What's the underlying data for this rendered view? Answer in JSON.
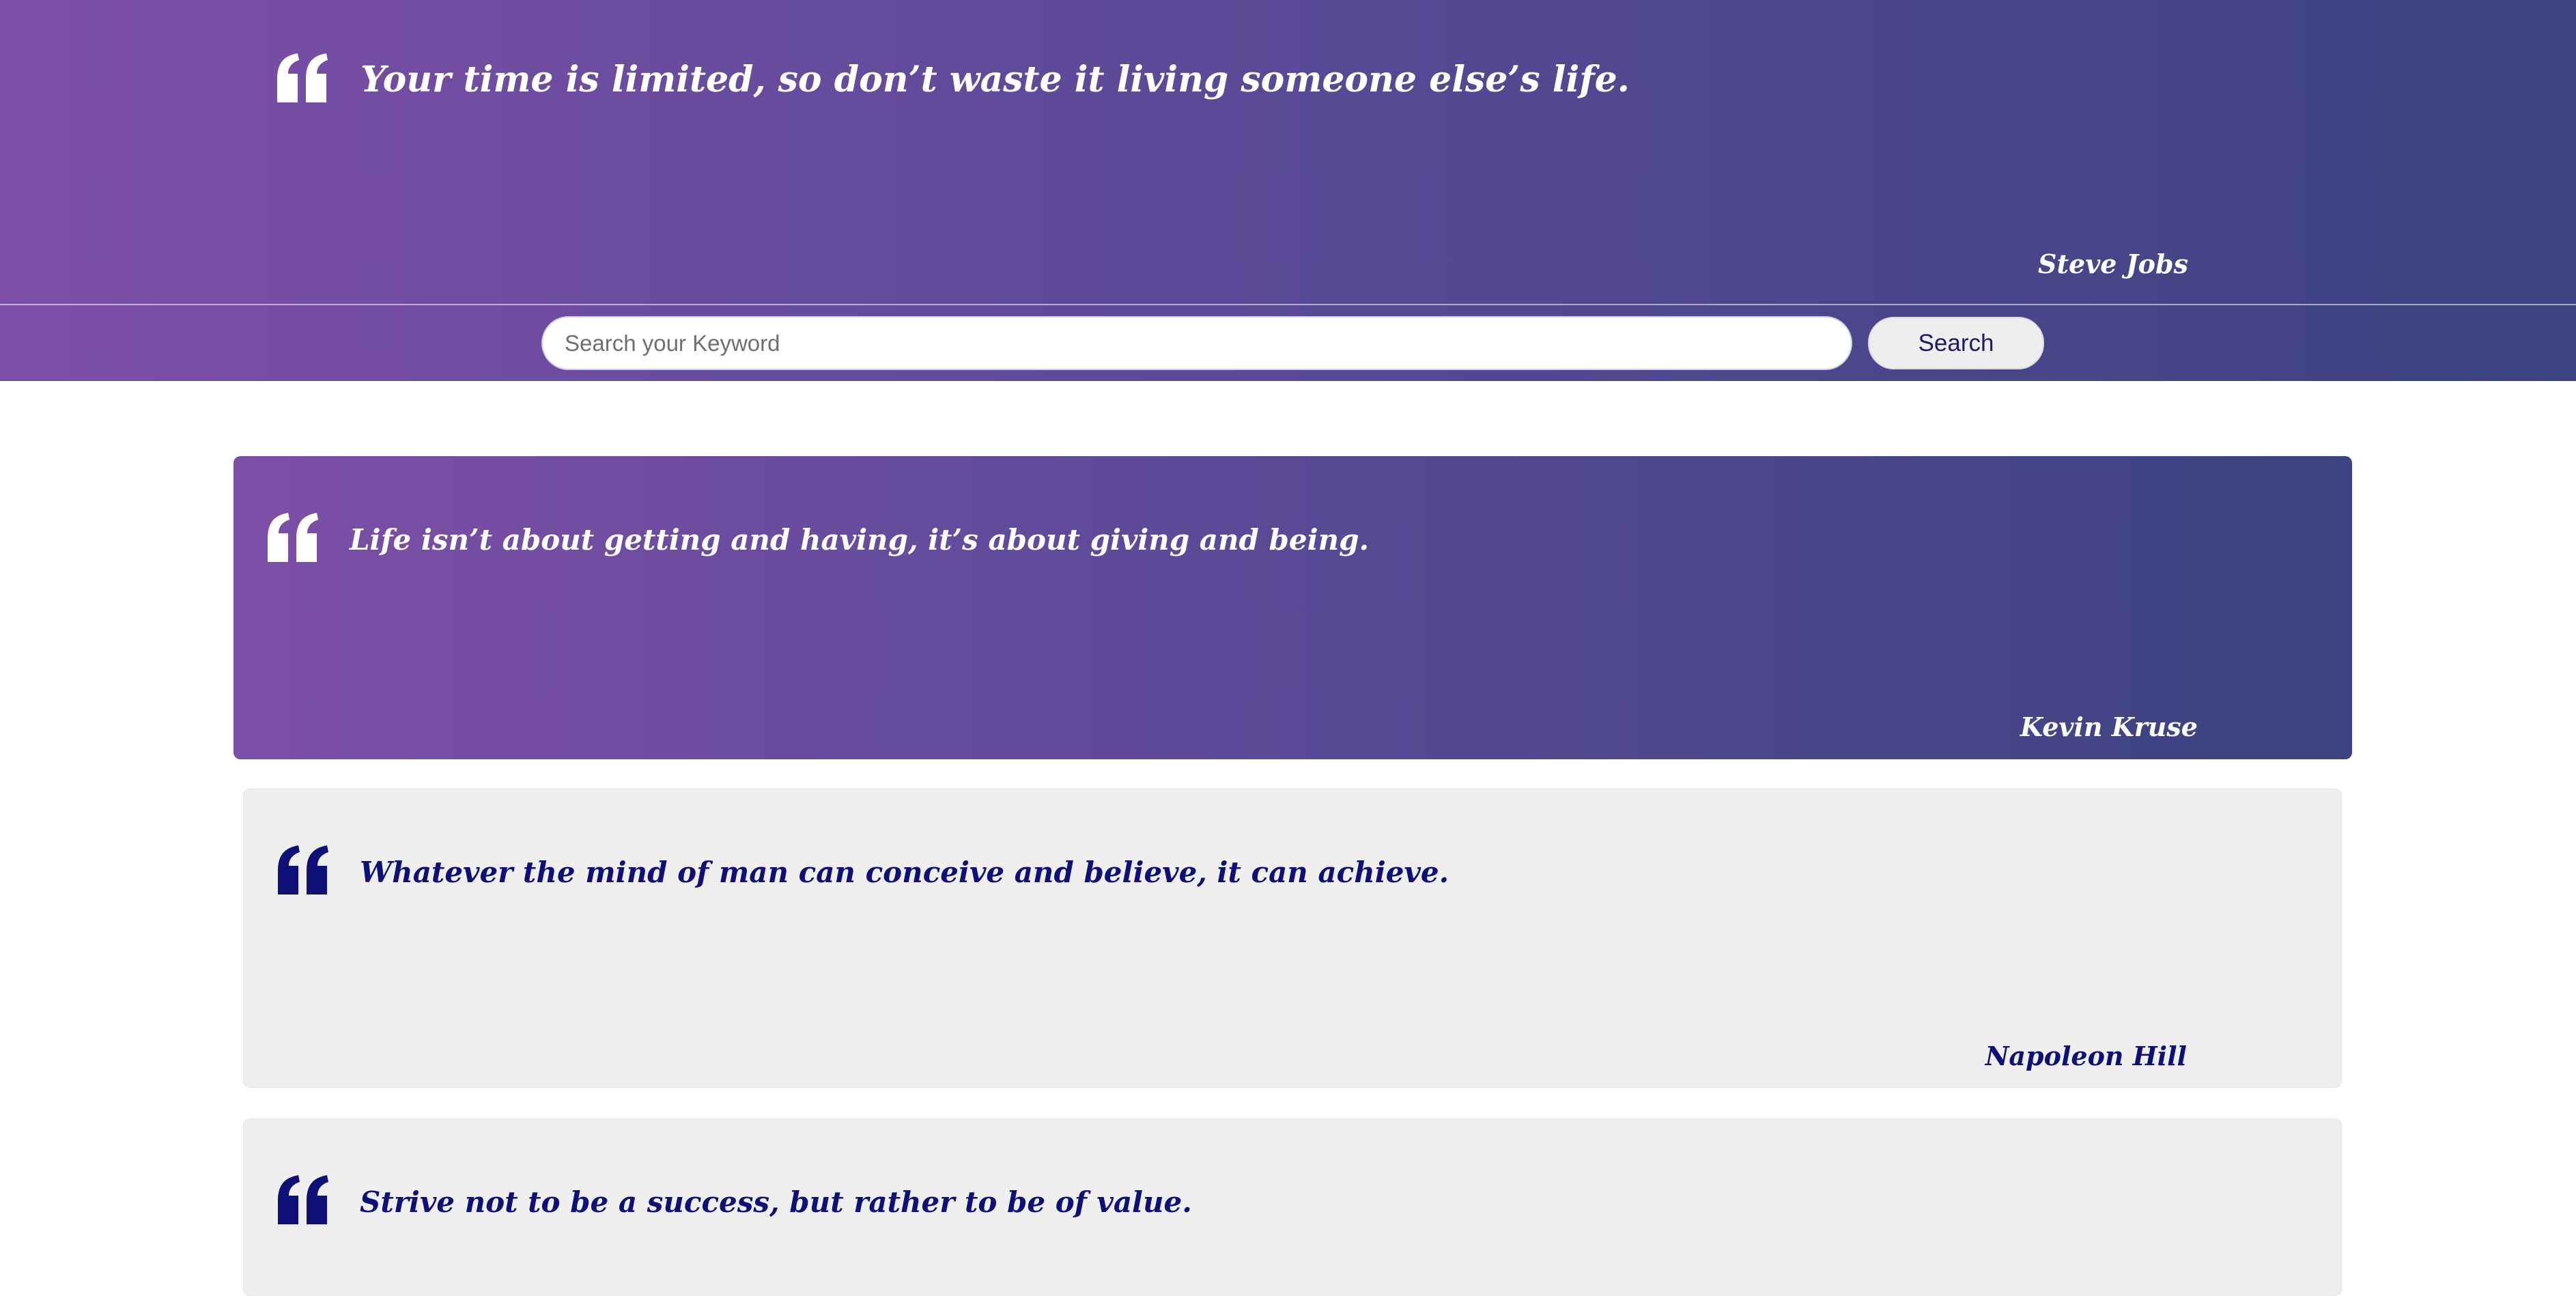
{
  "hero": {
    "quote": "Your time is limited, so don’t waste it living someone else’s life.",
    "author": "Steve Jobs",
    "quote_icon": "quote-icon",
    "background_gradient": [
      "#7d4fa7",
      "#3b4380"
    ]
  },
  "search": {
    "placeholder": "Search your Keyword",
    "value": "",
    "button_label": "Search"
  },
  "quotes": [
    {
      "text": "Life isn’t about getting and having, it’s about giving and being.",
      "author": "Kevin Kruse",
      "style": "highlighted"
    },
    {
      "text": "Whatever the mind of man can conceive and believe, it can achieve.",
      "author": "Napoleon Hill",
      "style": "plain"
    },
    {
      "text": "Strive not to be a success, but rather to be of value.",
      "author": "",
      "style": "plain"
    }
  ],
  "colors": {
    "accent_dark": "#0f0f78",
    "card_bg": "#efefef",
    "hero_text": "#ffffff"
  }
}
